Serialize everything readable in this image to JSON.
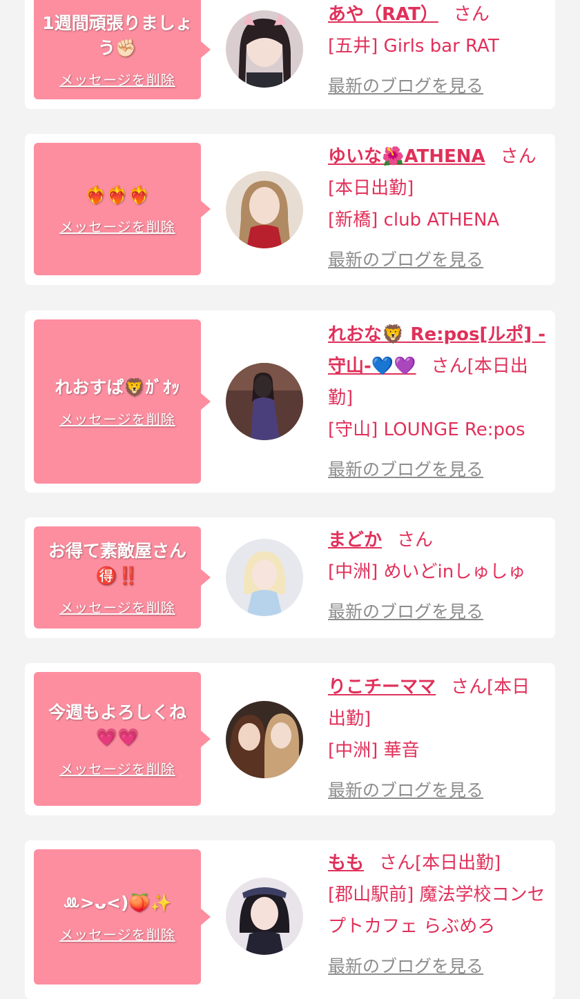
{
  "delete_label": "メッセージを削除",
  "blog_label": "最新のブログを見る",
  "san_label": "さん",
  "colors": {
    "accent": "#e0305a",
    "bubble": "#fd8ea0",
    "card": "#ffffff",
    "background": "#f3f3f3"
  },
  "cards": [
    {
      "message": "1週間頑張りましょう✊🏻",
      "name": "あや（RAT）",
      "status": "",
      "shop": "[五井] Girls bar RAT"
    },
    {
      "message": "❤️‍🔥❤️‍🔥❤️‍🔥",
      "name": "ゆいな🌺ATHENA",
      "status": "[本日出勤]",
      "shop": "[新橋] club ATHENA"
    },
    {
      "message": "れおすぱ🦁ｶﾞｵｯ",
      "name": "れおな🦁 Re:pos[ルポ] -守山-💙💜",
      "status": "[本日出勤]",
      "shop": "[守山] LOUNGE Re:pos"
    },
    {
      "message": "お得て素敵屋さん🉐‼️",
      "name": "まどか",
      "status": "",
      "shop": "[中洲] めいどinしゅしゅ"
    },
    {
      "message": "今週もよろしくね💗💗",
      "name": "りこチーママ",
      "status": "[本日出勤]",
      "shop": "[中洲] 華音"
    },
    {
      "message": "ꔛ>ᴗ<)🍑✨",
      "name": "もも",
      "status": "[本日出勤]",
      "shop": "[郡山駅前] 魔法学校コンセプトカフェ らぶめろ"
    }
  ]
}
